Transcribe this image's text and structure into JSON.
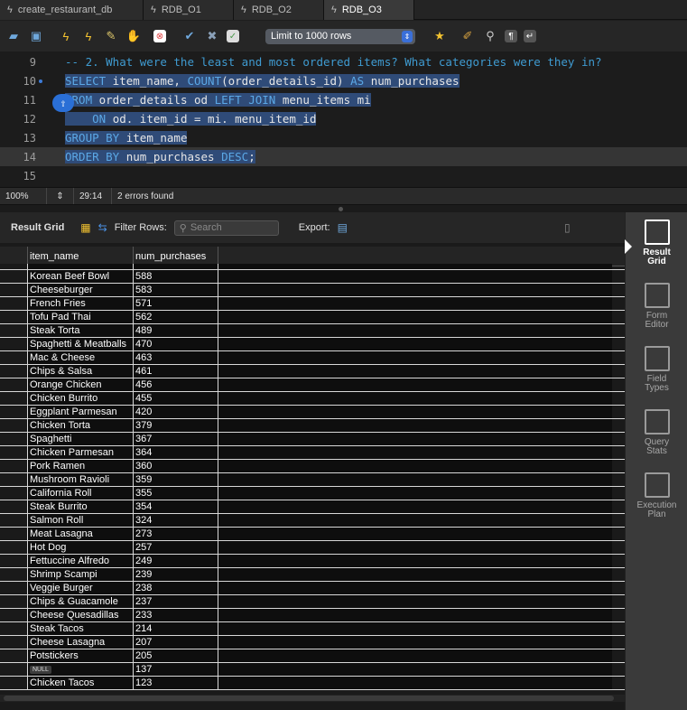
{
  "tabs": [
    {
      "label": "create_restaurant_db",
      "active": false
    },
    {
      "label": "RDB_O1",
      "active": false
    },
    {
      "label": "RDB_O2",
      "active": false
    },
    {
      "label": "RDB_O3",
      "active": true
    }
  ],
  "toolbar": {
    "limit_label": "Limit to 1000 rows"
  },
  "editor": {
    "lines": [
      {
        "num": "9"
      },
      {
        "num": "10"
      },
      {
        "num": "11"
      },
      {
        "num": "12"
      },
      {
        "num": "13"
      },
      {
        "num": "14"
      },
      {
        "num": "15"
      }
    ],
    "comment": "-- 2. What were the least and most ordered items? What categories were they in?",
    "l10_kw1": "SELECT",
    "l10_a": " item_name, ",
    "l10_fn": "COUNT",
    "l10_b": "(order_details_id) ",
    "l10_kw2": "AS",
    "l10_c": " num_purchases",
    "l11_kw1": "FROM",
    "l11_a": " order_details od ",
    "l11_kw2": "LEFT JOIN",
    "l11_b": " menu_items mi",
    "l12_kw": "ON",
    "l12_a": " od. item_id = mi. menu_item_id",
    "l13_kw": "GROUP BY",
    "l13_a": " item_name",
    "l14_kw1": "ORDER BY",
    "l14_a": " num_purchases ",
    "l14_kw2": "DESC",
    "l14_b": ";"
  },
  "status": {
    "zoom": "100%",
    "position": "29:14",
    "errors": "2 errors found"
  },
  "results": {
    "grid_label": "Result Grid",
    "filter_label": "Filter Rows:",
    "search_placeholder": "Search",
    "export_label": "Export:",
    "columns": [
      "item_name",
      "num_purchases"
    ],
    "rows": [
      [
        "Korean Beef Bowl",
        "588"
      ],
      [
        "Cheeseburger",
        "583"
      ],
      [
        "French Fries",
        "571"
      ],
      [
        "Tofu Pad Thai",
        "562"
      ],
      [
        "Steak Torta",
        "489"
      ],
      [
        "Spaghetti & Meatballs",
        "470"
      ],
      [
        "Mac & Cheese",
        "463"
      ],
      [
        "Chips & Salsa",
        "461"
      ],
      [
        "Orange Chicken",
        "456"
      ],
      [
        "Chicken Burrito",
        "455"
      ],
      [
        "Eggplant Parmesan",
        "420"
      ],
      [
        "Chicken Torta",
        "379"
      ],
      [
        "Spaghetti",
        "367"
      ],
      [
        "Chicken Parmesan",
        "364"
      ],
      [
        "Pork Ramen",
        "360"
      ],
      [
        "Mushroom Ravioli",
        "359"
      ],
      [
        "California Roll",
        "355"
      ],
      [
        "Steak Burrito",
        "354"
      ],
      [
        "Salmon Roll",
        "324"
      ],
      [
        "Meat Lasagna",
        "273"
      ],
      [
        "Hot Dog",
        "257"
      ],
      [
        "Fettuccine Alfredo",
        "249"
      ],
      [
        "Shrimp Scampi",
        "239"
      ],
      [
        "Veggie Burger",
        "238"
      ],
      [
        "Chips & Guacamole",
        "237"
      ],
      [
        "Cheese Quesadillas",
        "233"
      ],
      [
        "Steak Tacos",
        "214"
      ],
      [
        "Cheese Lasagna",
        "207"
      ],
      [
        "Potstickers",
        "205"
      ],
      [
        "NULL",
        "137"
      ],
      [
        "Chicken Tacos",
        "123"
      ]
    ]
  },
  "side_panel": [
    {
      "label1": "Result",
      "label2": "Grid",
      "active": true
    },
    {
      "label1": "Form",
      "label2": "Editor",
      "active": false
    },
    {
      "label1": "Field",
      "label2": "Types",
      "active": false
    },
    {
      "label1": "Query",
      "label2": "Stats",
      "active": false
    },
    {
      "label1": "Execution",
      "label2": "Plan",
      "active": false
    }
  ]
}
